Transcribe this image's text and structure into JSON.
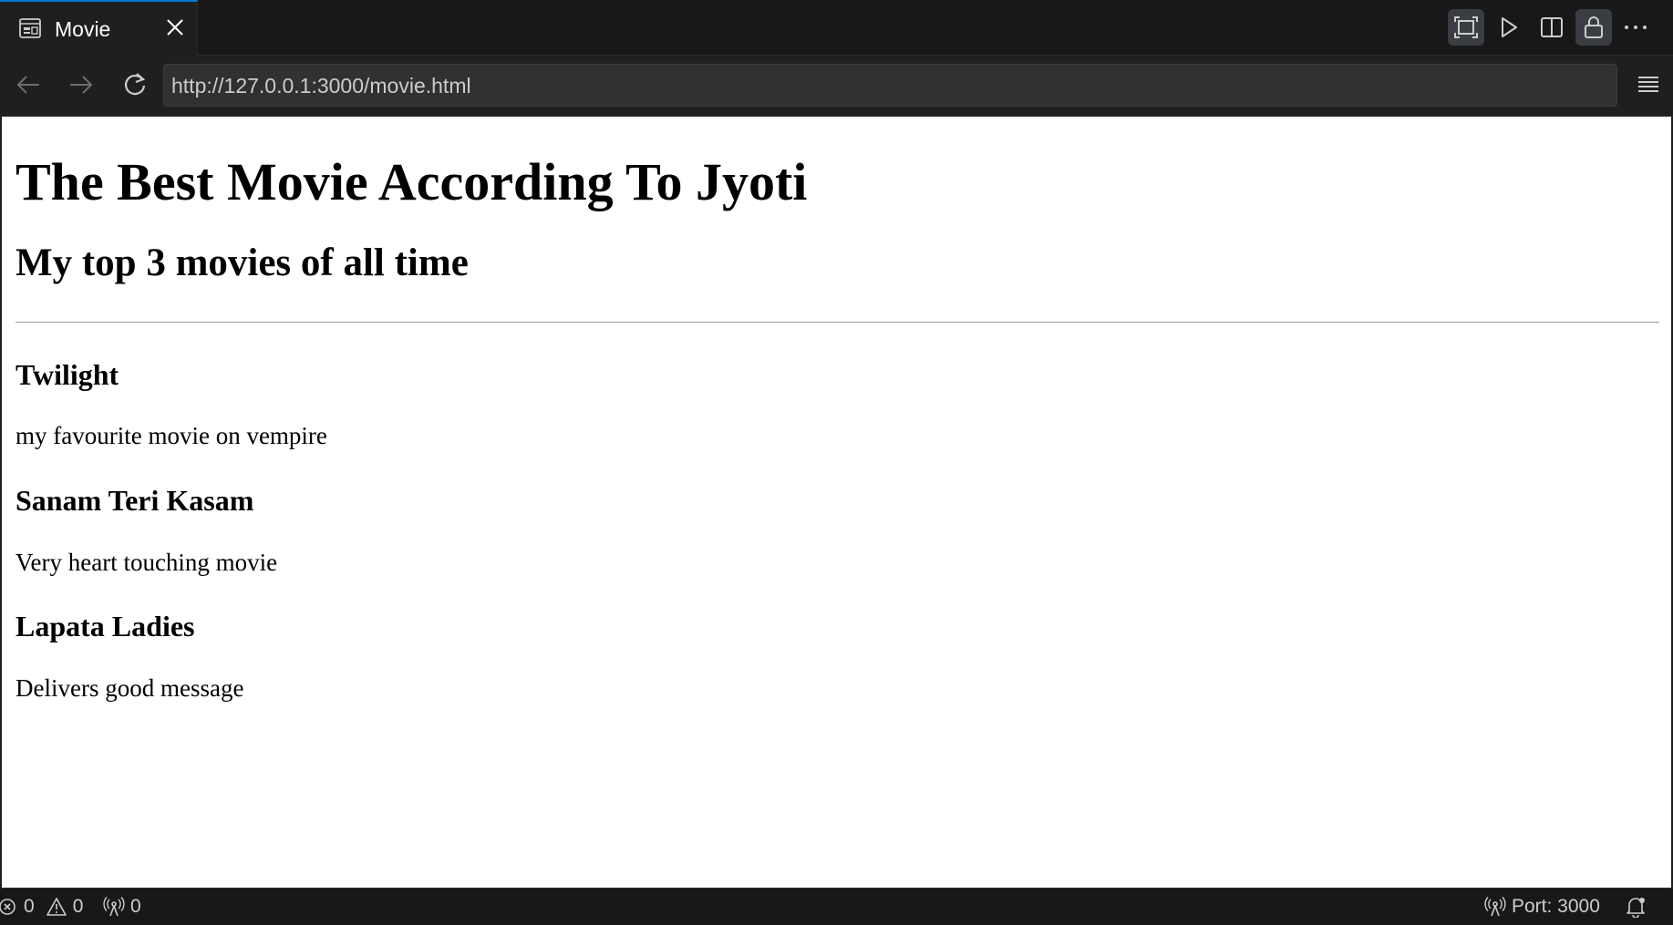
{
  "tab": {
    "title": "Movie",
    "icon": "preview-icon"
  },
  "toolbar": {
    "actions": [
      "fit-screen-icon",
      "play-icon",
      "split-editor-icon",
      "lock-icon",
      "more-icon"
    ]
  },
  "navigation": {
    "url": "http://127.0.0.1:3000/movie.html"
  },
  "page": {
    "heading": "The Best Movie According To Jyoti",
    "subheading": "My top 3 movies of all time",
    "movies": [
      {
        "title": "Twilight",
        "description": "my favourite movie on vempire"
      },
      {
        "title": "Sanam Teri Kasam",
        "description": "Very heart touching movie"
      },
      {
        "title": "Lapata Ladies",
        "description": "Delivers good message"
      }
    ]
  },
  "status": {
    "errors": "0",
    "warnings": "0",
    "ports_forwarded": "0",
    "port": "Port: 3000"
  },
  "colors": {
    "accent": "#0078d4",
    "chrome": "#1f1f1f",
    "page_bg": "#ffffff"
  }
}
